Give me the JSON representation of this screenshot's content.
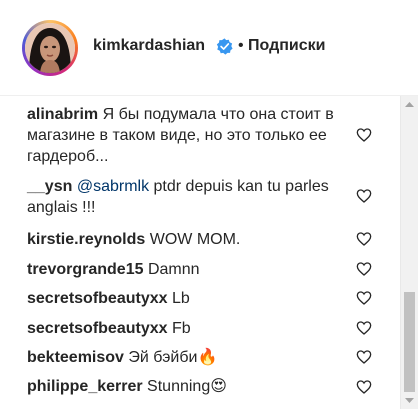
{
  "header": {
    "username": "kimkardashian",
    "separator": "•",
    "follow_label": "Подписки",
    "avatar_icon": "profile-photo",
    "verified_icon": "verified-badge-icon"
  },
  "comments": [
    {
      "user": "alinabrim",
      "text": " Я бы подумала что она стоит в магазине в таком виде, но это только ее гардероб..."
    },
    {
      "user": "__ysn",
      "mention": "@sabrmlk",
      "text": " ptdr depuis kan tu parles anglais !!!"
    },
    {
      "user": "kirstie.reynolds",
      "text": " WOW MOM."
    },
    {
      "user": "trevorgrande15",
      "text": " Damnn"
    },
    {
      "user": "secretsofbeautyxx",
      "text": " Lb"
    },
    {
      "user": "secretsofbeautyxx",
      "text": " Fb"
    },
    {
      "user": "bekteemisov",
      "text": " Эй бэйби🔥"
    },
    {
      "user": "philippe_kerrer",
      "text": " Stunning😍"
    }
  ],
  "colors": {
    "verified": "#3897f0",
    "text": "#262626",
    "scroll_thumb": "#c1c1c1"
  }
}
